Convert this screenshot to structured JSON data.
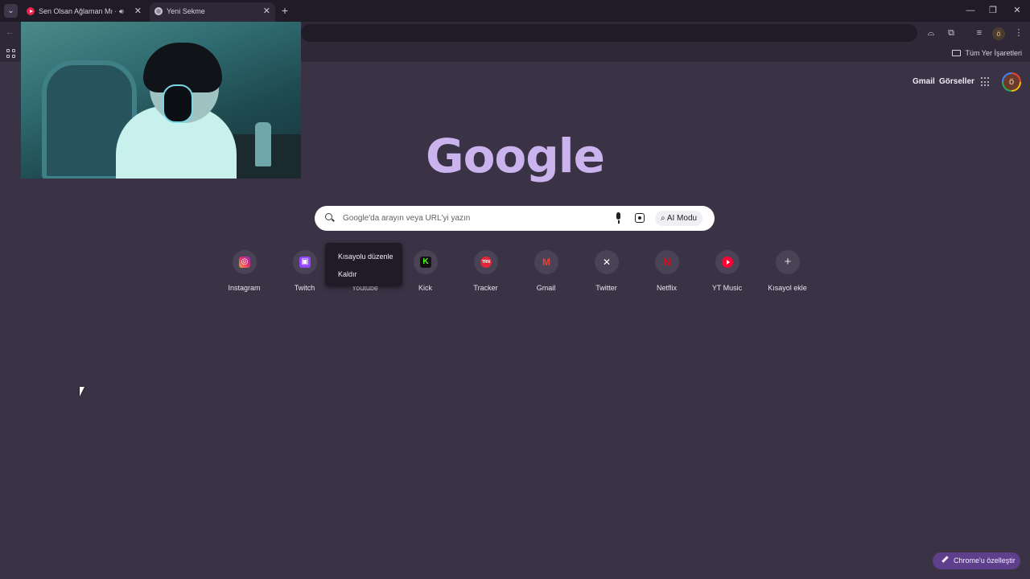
{
  "tabs": [
    {
      "title": "Sen Olsan Ağlaman Mı - YouTube",
      "icon": "youtube-icon",
      "audio": true
    },
    {
      "title": "Yeni Sekme",
      "icon": "chrome-icon",
      "active": true
    }
  ],
  "bookmarks_bar": {
    "all_bookmarks_label": "Tüm Yer İşaretleri"
  },
  "profile": {
    "initial": "ö"
  },
  "header": {
    "gmail": "Gmail",
    "images": "Görseller"
  },
  "logo": "Google",
  "search": {
    "placeholder": "Google'da arayın veya URL'yi yazın",
    "ai_mode": "AI Modu"
  },
  "shortcuts": [
    {
      "label": "Instagram",
      "icon": "instagram-icon",
      "glyph": "◎"
    },
    {
      "label": "Twitch",
      "icon": "twitch-icon",
      "glyph": "▣"
    },
    {
      "label": "Youtube",
      "icon": "youtube-icon",
      "glyph": "▶"
    },
    {
      "label": "Kick",
      "icon": "kick-icon",
      "glyph": "K"
    },
    {
      "label": "Tracker",
      "icon": "tracker-icon",
      "glyph": "TRN"
    },
    {
      "label": "Gmail",
      "icon": "gmail-icon",
      "glyph": "M"
    },
    {
      "label": "Twitter",
      "icon": "x-icon",
      "glyph": "✕"
    },
    {
      "label": "Netflix",
      "icon": "netflix-icon",
      "glyph": "N"
    },
    {
      "label": "YT Music",
      "icon": "youtube-music-icon",
      "glyph": ""
    },
    {
      "label": "Kısayol ekle",
      "icon": "plus-icon",
      "glyph": "+"
    }
  ],
  "context_menu": {
    "edit": "Kısayolu düzenle",
    "remove": "Kaldır"
  },
  "customize": {
    "label": "Chrome'u özelleştir"
  },
  "window_controls": {
    "minimize": "—",
    "restore": "❐",
    "close": "✕"
  },
  "colors": {
    "page_bg": "#3a3346",
    "logo": "#cbb3ee",
    "customize_bg": "#5d3f8c"
  }
}
